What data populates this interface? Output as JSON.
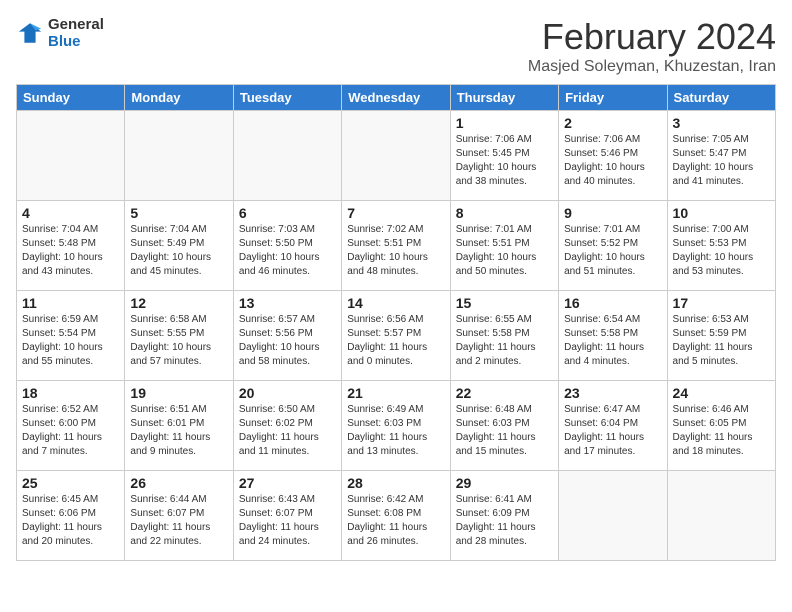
{
  "header": {
    "logo_general": "General",
    "logo_blue": "Blue",
    "month_title": "February 2024",
    "location": "Masjed Soleyman, Khuzestan, Iran"
  },
  "days_of_week": [
    "Sunday",
    "Monday",
    "Tuesday",
    "Wednesday",
    "Thursday",
    "Friday",
    "Saturday"
  ],
  "weeks": [
    [
      {
        "day": "",
        "info": ""
      },
      {
        "day": "",
        "info": ""
      },
      {
        "day": "",
        "info": ""
      },
      {
        "day": "",
        "info": ""
      },
      {
        "day": "1",
        "info": "Sunrise: 7:06 AM\nSunset: 5:45 PM\nDaylight: 10 hours\nand 38 minutes."
      },
      {
        "day": "2",
        "info": "Sunrise: 7:06 AM\nSunset: 5:46 PM\nDaylight: 10 hours\nand 40 minutes."
      },
      {
        "day": "3",
        "info": "Sunrise: 7:05 AM\nSunset: 5:47 PM\nDaylight: 10 hours\nand 41 minutes."
      }
    ],
    [
      {
        "day": "4",
        "info": "Sunrise: 7:04 AM\nSunset: 5:48 PM\nDaylight: 10 hours\nand 43 minutes."
      },
      {
        "day": "5",
        "info": "Sunrise: 7:04 AM\nSunset: 5:49 PM\nDaylight: 10 hours\nand 45 minutes."
      },
      {
        "day": "6",
        "info": "Sunrise: 7:03 AM\nSunset: 5:50 PM\nDaylight: 10 hours\nand 46 minutes."
      },
      {
        "day": "7",
        "info": "Sunrise: 7:02 AM\nSunset: 5:51 PM\nDaylight: 10 hours\nand 48 minutes."
      },
      {
        "day": "8",
        "info": "Sunrise: 7:01 AM\nSunset: 5:51 PM\nDaylight: 10 hours\nand 50 minutes."
      },
      {
        "day": "9",
        "info": "Sunrise: 7:01 AM\nSunset: 5:52 PM\nDaylight: 10 hours\nand 51 minutes."
      },
      {
        "day": "10",
        "info": "Sunrise: 7:00 AM\nSunset: 5:53 PM\nDaylight: 10 hours\nand 53 minutes."
      }
    ],
    [
      {
        "day": "11",
        "info": "Sunrise: 6:59 AM\nSunset: 5:54 PM\nDaylight: 10 hours\nand 55 minutes."
      },
      {
        "day": "12",
        "info": "Sunrise: 6:58 AM\nSunset: 5:55 PM\nDaylight: 10 hours\nand 57 minutes."
      },
      {
        "day": "13",
        "info": "Sunrise: 6:57 AM\nSunset: 5:56 PM\nDaylight: 10 hours\nand 58 minutes."
      },
      {
        "day": "14",
        "info": "Sunrise: 6:56 AM\nSunset: 5:57 PM\nDaylight: 11 hours\nand 0 minutes."
      },
      {
        "day": "15",
        "info": "Sunrise: 6:55 AM\nSunset: 5:58 PM\nDaylight: 11 hours\nand 2 minutes."
      },
      {
        "day": "16",
        "info": "Sunrise: 6:54 AM\nSunset: 5:58 PM\nDaylight: 11 hours\nand 4 minutes."
      },
      {
        "day": "17",
        "info": "Sunrise: 6:53 AM\nSunset: 5:59 PM\nDaylight: 11 hours\nand 5 minutes."
      }
    ],
    [
      {
        "day": "18",
        "info": "Sunrise: 6:52 AM\nSunset: 6:00 PM\nDaylight: 11 hours\nand 7 minutes."
      },
      {
        "day": "19",
        "info": "Sunrise: 6:51 AM\nSunset: 6:01 PM\nDaylight: 11 hours\nand 9 minutes."
      },
      {
        "day": "20",
        "info": "Sunrise: 6:50 AM\nSunset: 6:02 PM\nDaylight: 11 hours\nand 11 minutes."
      },
      {
        "day": "21",
        "info": "Sunrise: 6:49 AM\nSunset: 6:03 PM\nDaylight: 11 hours\nand 13 minutes."
      },
      {
        "day": "22",
        "info": "Sunrise: 6:48 AM\nSunset: 6:03 PM\nDaylight: 11 hours\nand 15 minutes."
      },
      {
        "day": "23",
        "info": "Sunrise: 6:47 AM\nSunset: 6:04 PM\nDaylight: 11 hours\nand 17 minutes."
      },
      {
        "day": "24",
        "info": "Sunrise: 6:46 AM\nSunset: 6:05 PM\nDaylight: 11 hours\nand 18 minutes."
      }
    ],
    [
      {
        "day": "25",
        "info": "Sunrise: 6:45 AM\nSunset: 6:06 PM\nDaylight: 11 hours\nand 20 minutes."
      },
      {
        "day": "26",
        "info": "Sunrise: 6:44 AM\nSunset: 6:07 PM\nDaylight: 11 hours\nand 22 minutes."
      },
      {
        "day": "27",
        "info": "Sunrise: 6:43 AM\nSunset: 6:07 PM\nDaylight: 11 hours\nand 24 minutes."
      },
      {
        "day": "28",
        "info": "Sunrise: 6:42 AM\nSunset: 6:08 PM\nDaylight: 11 hours\nand 26 minutes."
      },
      {
        "day": "29",
        "info": "Sunrise: 6:41 AM\nSunset: 6:09 PM\nDaylight: 11 hours\nand 28 minutes."
      },
      {
        "day": "",
        "info": ""
      },
      {
        "day": "",
        "info": ""
      }
    ]
  ]
}
